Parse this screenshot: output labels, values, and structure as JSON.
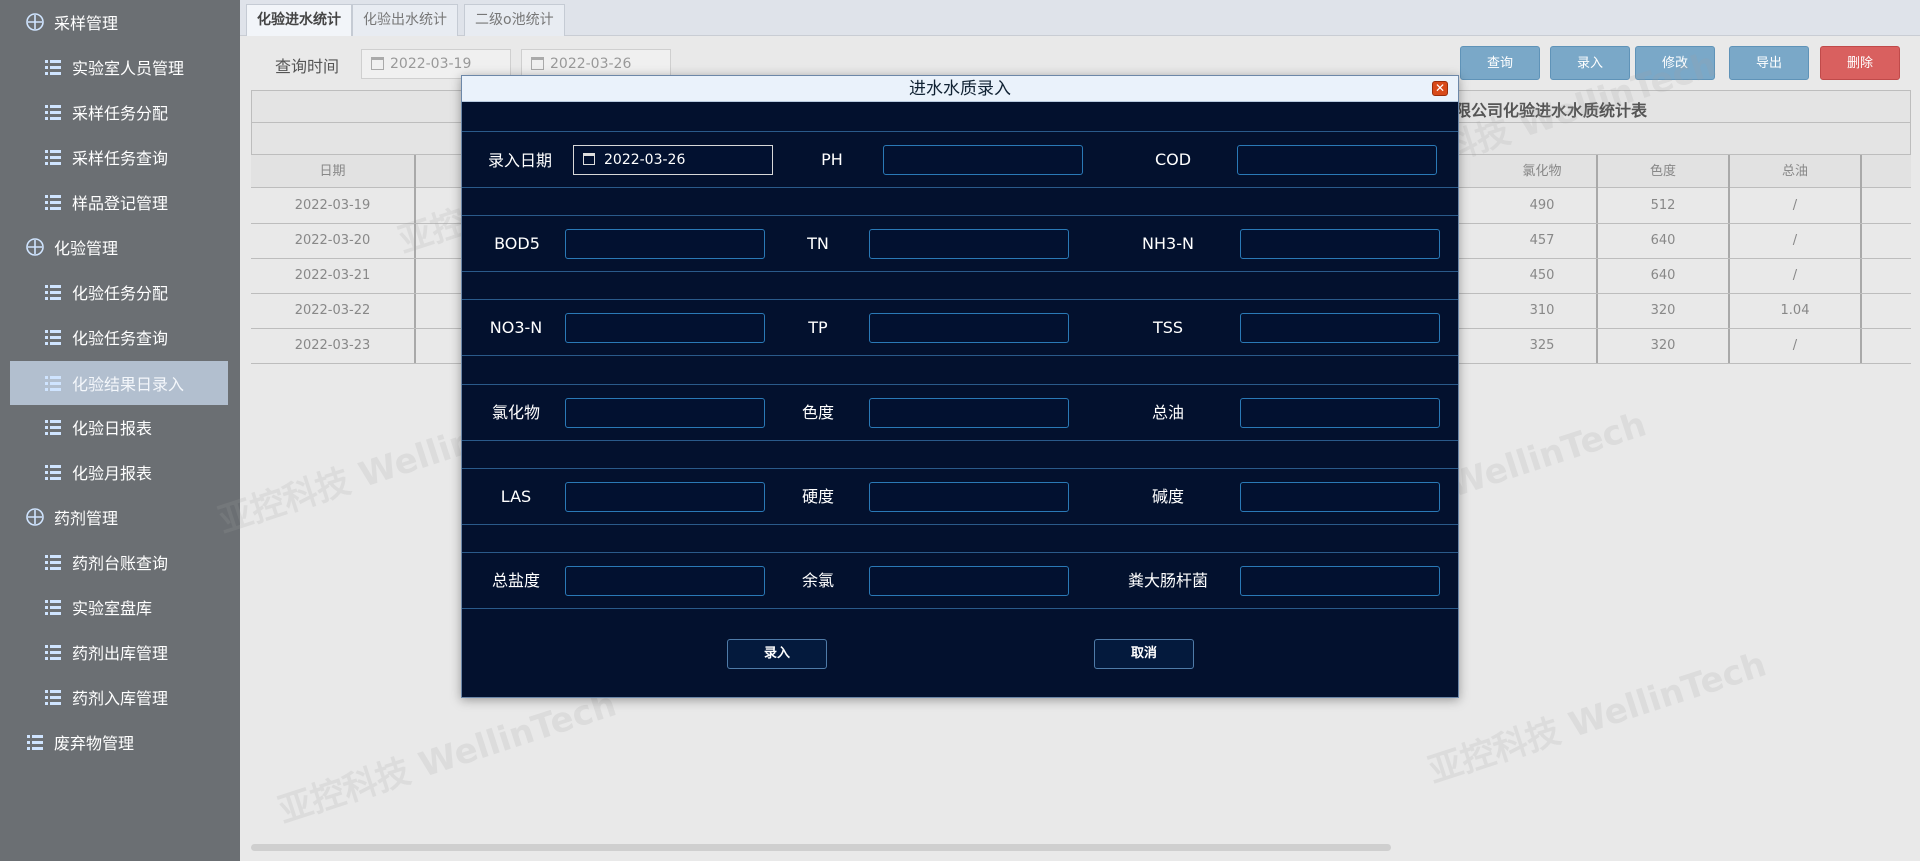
{
  "sidebar": {
    "groups": [
      {
        "label": "采样管理",
        "icon": "grid-icon"
      },
      {
        "label": "化验管理",
        "icon": "grid-icon"
      },
      {
        "label": "药剂管理",
        "icon": "grid-icon"
      },
      {
        "label": "废弃物管理",
        "icon": "list-icon"
      }
    ],
    "items": [
      {
        "label": "实验室人员管理"
      },
      {
        "label": "采样任务分配"
      },
      {
        "label": "采样任务查询"
      },
      {
        "label": "样品登记管理"
      },
      {
        "label": "化验任务分配"
      },
      {
        "label": "化验任务查询"
      },
      {
        "label": "化验结果日录入"
      },
      {
        "label": "化验日报表"
      },
      {
        "label": "化验月报表"
      },
      {
        "label": "药剂台账查询"
      },
      {
        "label": "实验室盘库"
      },
      {
        "label": "药剂出库管理"
      },
      {
        "label": "药剂入库管理"
      }
    ]
  },
  "tabs": [
    {
      "label": "化验进水统计"
    },
    {
      "label": "化验出水统计"
    },
    {
      "label": "二级o池统计"
    }
  ],
  "query": {
    "label": "查询时间",
    "start_date": "2022-03-19",
    "end_date": "2022-03-26"
  },
  "toolbar": {
    "query": "查询",
    "add": "录入",
    "edit": "修改",
    "export": "导出",
    "delete": "删除",
    "delete_color": "#d9605f",
    "button_color": "#7aa8c8"
  },
  "table": {
    "title": "限公司化验进水水质统计表",
    "headers": {
      "date": "日期",
      "chloride": "氯化物",
      "chroma": "色度",
      "oil": "总油"
    },
    "rows": [
      {
        "date": "2022-03-19",
        "chloride": "490",
        "chroma": "512",
        "oil": "/"
      },
      {
        "date": "2022-03-20",
        "chloride": "457",
        "chroma": "640",
        "oil": "/"
      },
      {
        "date": "2022-03-21",
        "chloride": "450",
        "chroma": "640",
        "oil": "/"
      },
      {
        "date": "2022-03-22",
        "chloride": "310",
        "chroma": "320",
        "oil": "1.04"
      },
      {
        "date": "2022-03-23",
        "chloride": "325",
        "chroma": "320",
        "oil": "/"
      }
    ]
  },
  "watermark": "亚控科技 WellinTech",
  "modal": {
    "title": "进水水质录入",
    "rows": [
      [
        {
          "label": "录入日期",
          "value": "2022-03-26"
        },
        {
          "label": "PH",
          "value": ""
        },
        {
          "label": "COD",
          "value": ""
        }
      ],
      [
        {
          "label": "BOD5",
          "value": ""
        },
        {
          "label": "TN",
          "value": ""
        },
        {
          "label": "NH3-N",
          "value": ""
        }
      ],
      [
        {
          "label": "NO3-N",
          "value": ""
        },
        {
          "label": "TP",
          "value": ""
        },
        {
          "label": "TSS",
          "value": ""
        }
      ],
      [
        {
          "label": "氯化物",
          "value": ""
        },
        {
          "label": "色度",
          "value": ""
        },
        {
          "label": "总油",
          "value": ""
        }
      ],
      [
        {
          "label": "LAS",
          "value": ""
        },
        {
          "label": "硬度",
          "value": ""
        },
        {
          "label": "碱度",
          "value": ""
        }
      ],
      [
        {
          "label": "总盐度",
          "value": ""
        },
        {
          "label": "余氯",
          "value": ""
        },
        {
          "label": "粪大肠杆菌",
          "value": ""
        }
      ]
    ],
    "submit": "录入",
    "cancel": "取消"
  }
}
